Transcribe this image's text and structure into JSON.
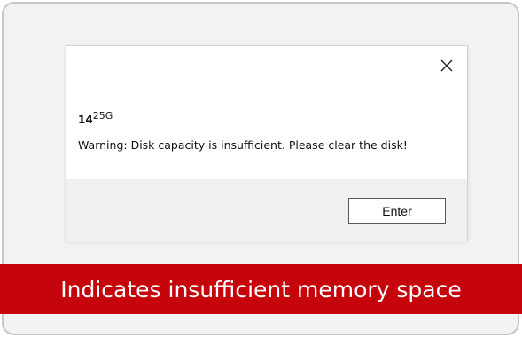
{
  "dialog": {
    "close_icon": "close-icon",
    "disk_size": {
      "main": "14",
      "superscript": "25G"
    },
    "message": "Warning: Disk capacity is insufficient. Please clear the disk!",
    "enter_label": "Enter"
  },
  "caption": {
    "text": "Indicates insufficient memory space",
    "background_color": "#c5040b"
  }
}
